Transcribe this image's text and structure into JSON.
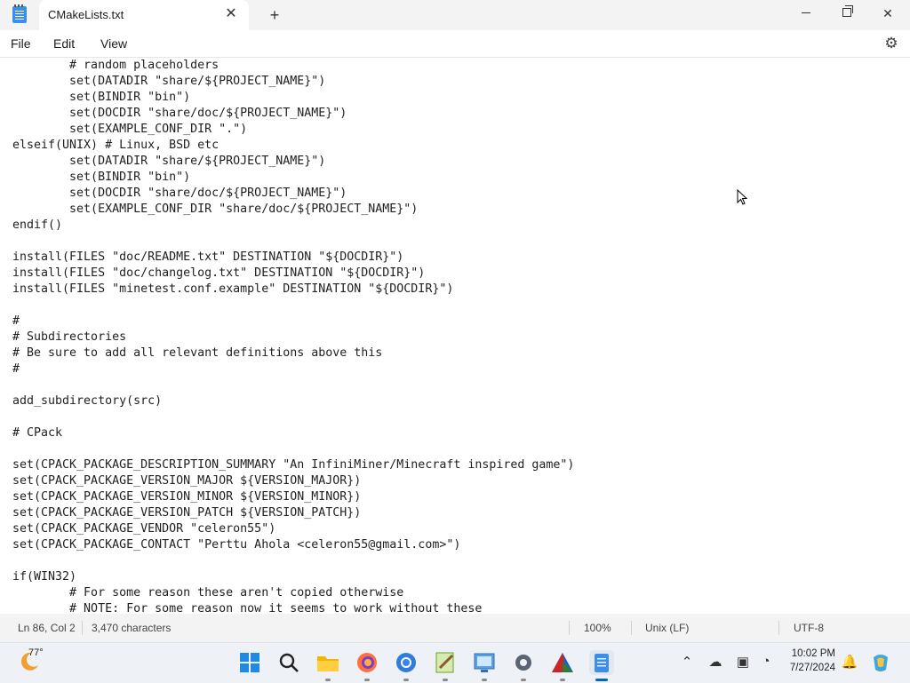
{
  "window": {
    "tab_title": "CMakeLists.txt",
    "tab_close": "✕",
    "new_tab": "+",
    "minimize": "",
    "maximize": "",
    "close": "✕"
  },
  "menu": {
    "file": "File",
    "edit": "Edit",
    "view": "View",
    "settings_icon": "⚙"
  },
  "editor": {
    "lines": [
      "        # random placeholders",
      "        set(DATADIR \"share/${PROJECT_NAME}\")",
      "        set(BINDIR \"bin\")",
      "        set(DOCDIR \"share/doc/${PROJECT_NAME}\")",
      "        set(EXAMPLE_CONF_DIR \".\")",
      "elseif(UNIX) # Linux, BSD etc",
      "        set(DATADIR \"share/${PROJECT_NAME}\")",
      "        set(BINDIR \"bin\")",
      "        set(DOCDIR \"share/doc/${PROJECT_NAME}\")",
      "        set(EXAMPLE_CONF_DIR \"share/doc/${PROJECT_NAME}\")",
      "endif()",
      "",
      "install(FILES \"doc/README.txt\" DESTINATION \"${DOCDIR}\")",
      "install(FILES \"doc/changelog.txt\" DESTINATION \"${DOCDIR}\")",
      "install(FILES \"minetest.conf.example\" DESTINATION \"${DOCDIR}\")",
      "",
      "#",
      "# Subdirectories",
      "# Be sure to add all relevant definitions above this",
      "#",
      "",
      "add_subdirectory(src)",
      "",
      "# CPack",
      "",
      "set(CPACK_PACKAGE_DESCRIPTION_SUMMARY \"An InfiniMiner/Minecraft inspired game\")",
      "set(CPACK_PACKAGE_VERSION_MAJOR ${VERSION_MAJOR})",
      "set(CPACK_PACKAGE_VERSION_MINOR ${VERSION_MINOR})",
      "set(CPACK_PACKAGE_VERSION_PATCH ${VERSION_PATCH})",
      "set(CPACK_PACKAGE_VENDOR \"celeron55\")",
      "set(CPACK_PACKAGE_CONTACT \"Perttu Ahola <celeron55@gmail.com>\")",
      "",
      "if(WIN32)",
      "        # For some reason these aren't copied otherwise",
      "        # NOTE: For some reason now it seems to work without these"
    ]
  },
  "status": {
    "position": "Ln 86, Col 2",
    "characters": "3,470 characters",
    "zoom": "100%",
    "line_ending": "Unix (LF)",
    "encoding": "UTF-8"
  },
  "taskbar": {
    "weather_temp": "77°",
    "time": "10:02 PM",
    "date": "7/27/2024",
    "apps": [
      "start-icon",
      "search-icon",
      "file-explorer-icon",
      "firefox-icon",
      "chrome-icon",
      "notepad-plus-icon",
      "control-panel-icon",
      "settings-icon",
      "cmake-icon",
      "notepad-icon"
    ]
  },
  "colors": {
    "accent": "#0067c0",
    "titlebar_bg": "#f3f3f3",
    "taskbar_bg": "#eef1f6"
  }
}
